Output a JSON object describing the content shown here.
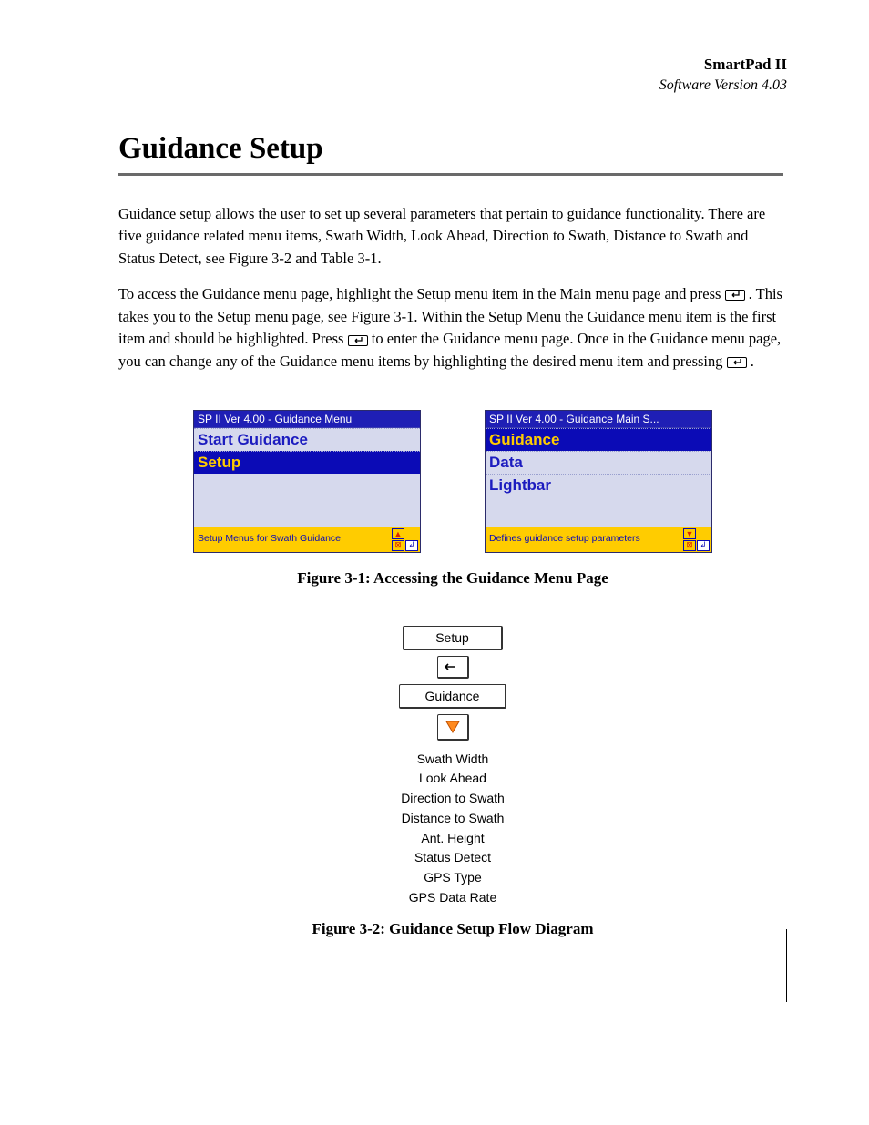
{
  "header": {
    "product": "SmartPad II",
    "version": "Software Version 4.03"
  },
  "title": "Guidance Setup",
  "paragraphs": {
    "p1": "Guidance setup allows the user to set up several parameters that pertain to guidance functionality. There are five guidance related menu items, Swath Width, Look Ahead, Direction to Swath, Distance to Swath and Status Detect, see Figure 3-2 and Table 3-1.",
    "p2a": "To access the Guidance menu page, highlight the Setup menu item in the Main menu page and press ",
    "p2b": ". This takes you to the Setup menu page, see Figure 3-1. Within the Setup Menu the Guidance menu item is the first item and should be highlighted. Press ",
    "p2c": " to enter the Guidance menu page. Once in the Guidance menu page, you can change any of the Guidance menu items by highlighting the desired menu item and pressing ",
    "p2d": "."
  },
  "screens": {
    "left": {
      "title": "SP II Ver 4.00 - Guidance Menu",
      "items": [
        "Start Guidance",
        "Setup"
      ],
      "highlightIndex": 1,
      "status": "Setup Menus for Swath Guidance"
    },
    "right": {
      "title": "SP II Ver 4.00 - Guidance Main S...",
      "items": [
        "Guidance",
        "Data",
        "Lightbar"
      ],
      "highlightIndex": 0,
      "status": "Defines guidance setup parameters"
    }
  },
  "captions": {
    "fig1": "Figure 3-1: Accessing the Guidance Menu Page",
    "fig2": "Figure 3-2: Guidance Setup Flow Diagram"
  },
  "flow": {
    "box1": "Setup",
    "box2": "Guidance",
    "list": [
      "Swath Width",
      "Look Ahead",
      "Direction to Swath",
      "Distance to Swath",
      "Ant. Height",
      "Status Detect",
      "GPS Type",
      "GPS Data Rate"
    ]
  }
}
